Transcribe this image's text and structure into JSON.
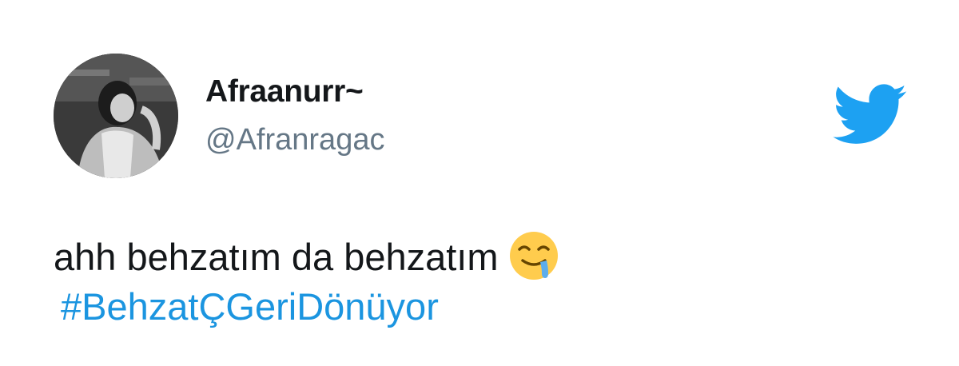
{
  "user": {
    "display_name": "Afraanurr~",
    "handle": "@Afranragac",
    "avatar_icon": "profile-photo"
  },
  "tweet": {
    "text": "ahh behzatım da behzatım",
    "emoji": "drooling-face-emoji",
    "hashtag": "#BehzatÇGeriDönüyor"
  },
  "brand": {
    "logo_icon": "twitter-bird-icon",
    "accent_color": "#1da1f2",
    "link_color": "#1b95e0",
    "handle_color": "#657786",
    "text_color": "#14171a"
  }
}
